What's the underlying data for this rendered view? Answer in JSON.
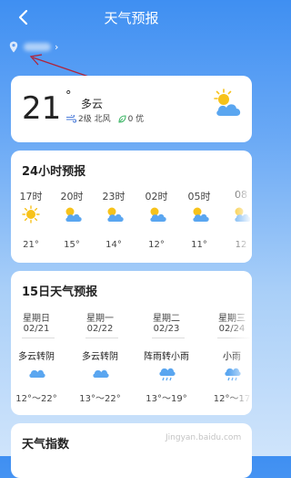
{
  "header": {
    "title": "天气预报"
  },
  "current": {
    "temperature": "21",
    "degree_symbol": "°",
    "condition": "多云",
    "wind": "2级 北风",
    "aqi": "0 优"
  },
  "hourly": {
    "title": "24小时预报",
    "items": [
      {
        "time": "17时",
        "icon": "sunny-icon",
        "temp": "21°"
      },
      {
        "time": "20时",
        "icon": "partly-cloudy-icon",
        "temp": "15°"
      },
      {
        "time": "23时",
        "icon": "partly-cloudy-icon",
        "temp": "14°"
      },
      {
        "time": "02时",
        "icon": "partly-cloudy-icon",
        "temp": "12°"
      },
      {
        "time": "05时",
        "icon": "partly-cloudy-icon",
        "temp": "11°"
      },
      {
        "time": "08",
        "icon": "partly-cloudy-icon",
        "temp": "12"
      }
    ]
  },
  "daily": {
    "title": "15日天气预报",
    "items": [
      {
        "day": "星期日",
        "date": "02/21",
        "condition": "多云转阴",
        "icon": "cloud-icon",
        "range": "12°～22°"
      },
      {
        "day": "星期一",
        "date": "02/22",
        "condition": "多云转阴",
        "icon": "cloud-icon",
        "range": "13°～22°"
      },
      {
        "day": "星期二",
        "date": "02/23",
        "condition": "阵雨转小雨",
        "icon": "rain-cloud-icon",
        "range": "13°～19°"
      },
      {
        "day": "星期三",
        "date": "02/24",
        "condition": "小雨",
        "icon": "rain-cloud-icon",
        "range": "12°～17"
      }
    ]
  },
  "index": {
    "title": "天气指数"
  },
  "watermark": "Jingyan.baidu.com",
  "colors": {
    "background_top": "#3f8ff2",
    "card": "#ffffff",
    "sun": "#f7c21a",
    "cloud": "#5aa6f0",
    "wind_icon": "#4a7bd9",
    "aqi_icon": "#42b86a",
    "annotation_arrow": "#b0243a"
  }
}
